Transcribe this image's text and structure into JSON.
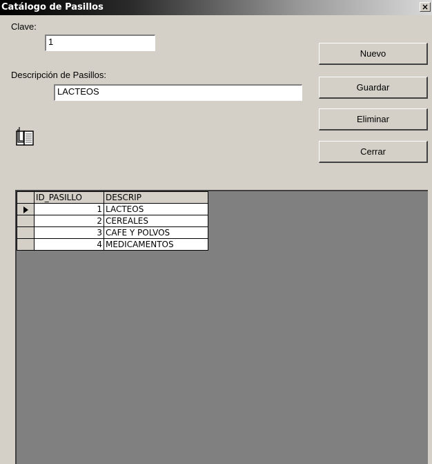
{
  "window": {
    "title": "Catálogo de Pasillos",
    "close_glyph": "×"
  },
  "form": {
    "clave_label": "Clave:",
    "clave_value": "1",
    "descripcion_label": "Descripción de Pasillos:",
    "descripcion_value": "LACTEOS"
  },
  "buttons": {
    "nuevo": "Nuevo",
    "guardar": "Guardar",
    "eliminar": "Eliminar",
    "cerrar": "Cerrar"
  },
  "icons": {
    "book": "book-icon"
  },
  "grid": {
    "columns": [
      "ID_PASILLO",
      "DESCRIP"
    ],
    "current_row_index": 0,
    "rows": [
      {
        "id": "1",
        "descrip": "LACTEOS"
      },
      {
        "id": "2",
        "descrip": "CEREALES"
      },
      {
        "id": "3",
        "descrip": "CAFE Y POLVOS"
      },
      {
        "id": "4",
        "descrip": "MEDICAMENTOS"
      }
    ]
  },
  "colors": {
    "face": "#d4d0c8",
    "grid_background": "#808080",
    "title_start": "#000000",
    "title_end": "#d9d9d9"
  }
}
